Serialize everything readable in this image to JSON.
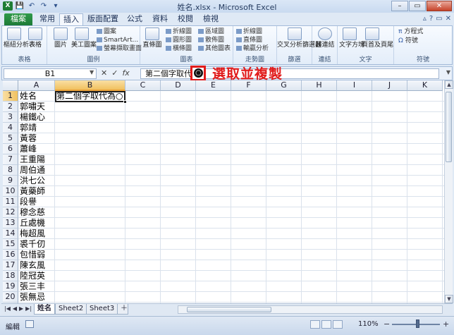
{
  "window": {
    "title": "姓名.xlsx - Microsoft Excel",
    "controls": [
      "–",
      "▭",
      "✕"
    ]
  },
  "quick_access": [
    "X",
    "💾",
    "↶",
    "↷",
    "▾"
  ],
  "ribbon": {
    "tabs": [
      "檔案",
      "常用",
      "插入",
      "版面配置",
      "公式",
      "資料",
      "校閱",
      "檢視"
    ],
    "active_tab": "插入",
    "groups": [
      {
        "label": "表格",
        "buttons": [
          "樞紐分析表",
          "表格"
        ]
      },
      {
        "label": "圖例",
        "buttons": [
          "圖片",
          "美工圖案",
          "圖案",
          "SmartArt...",
          "螢幕擷取畫面"
        ]
      },
      {
        "label": "圖表",
        "buttons": [
          "直條圖",
          "折線圖",
          "圓形圖",
          "橫條圖",
          "區域圖",
          "散佈圖",
          "其他圖表"
        ]
      },
      {
        "label": "走勢圖",
        "buttons": [
          "折線圖",
          "直條圖",
          "輸贏分析"
        ]
      },
      {
        "label": "篩選",
        "buttons": [
          "交叉分析篩選器"
        ]
      },
      {
        "label": "連結",
        "buttons": [
          "超連結"
        ]
      },
      {
        "label": "文字",
        "buttons": [
          "文字方塊",
          "頁首及頁尾"
        ]
      },
      {
        "label": "符號",
        "buttons": [
          "方程式",
          "符號"
        ]
      }
    ]
  },
  "formula_bar": {
    "name_box": "B1",
    "tools": [
      "✕",
      "✓",
      "fx"
    ],
    "content": "第二個字取代為"
  },
  "annotation": {
    "glyph": "○",
    "text": "選取並複製"
  },
  "sheet": {
    "columns": [
      "A",
      "B",
      "C",
      "D",
      "E",
      "F",
      "G",
      "H",
      "I",
      "J",
      "K"
    ],
    "selected_column": "B",
    "selected_row": 1,
    "rows": [
      {
        "n": "1",
        "a": "姓名",
        "b": "第二個字取代為○"
      },
      {
        "n": "2",
        "a": "郭嘯天",
        "b": ""
      },
      {
        "n": "3",
        "a": "楊鐵心",
        "b": ""
      },
      {
        "n": "4",
        "a": "郭靖",
        "b": ""
      },
      {
        "n": "5",
        "a": "黃蓉",
        "b": ""
      },
      {
        "n": "6",
        "a": "蕭峰",
        "b": ""
      },
      {
        "n": "7",
        "a": "王重陽",
        "b": ""
      },
      {
        "n": "8",
        "a": "周伯通",
        "b": ""
      },
      {
        "n": "9",
        "a": "洪七公",
        "b": ""
      },
      {
        "n": "10",
        "a": "黃藥師",
        "b": ""
      },
      {
        "n": "11",
        "a": "段譽",
        "b": ""
      },
      {
        "n": "12",
        "a": "穆念慈",
        "b": ""
      },
      {
        "n": "13",
        "a": "丘處機",
        "b": ""
      },
      {
        "n": "14",
        "a": "梅超風",
        "b": ""
      },
      {
        "n": "15",
        "a": "裘千仞",
        "b": ""
      },
      {
        "n": "16",
        "a": "包惜弱",
        "b": ""
      },
      {
        "n": "17",
        "a": "陳玄風",
        "b": ""
      },
      {
        "n": "18",
        "a": "陸冠英",
        "b": ""
      },
      {
        "n": "19",
        "a": "張三丰",
        "b": ""
      },
      {
        "n": "20",
        "a": "張無忌",
        "b": ""
      },
      {
        "n": "21",
        "a": "",
        "b": ""
      }
    ]
  },
  "sheet_tabs": [
    "姓名",
    "Sheet2",
    "Sheet3"
  ],
  "active_sheet": "姓名",
  "status": {
    "mode": "編輯",
    "zoom": "110%",
    "zoom_fraction": 0.55
  }
}
